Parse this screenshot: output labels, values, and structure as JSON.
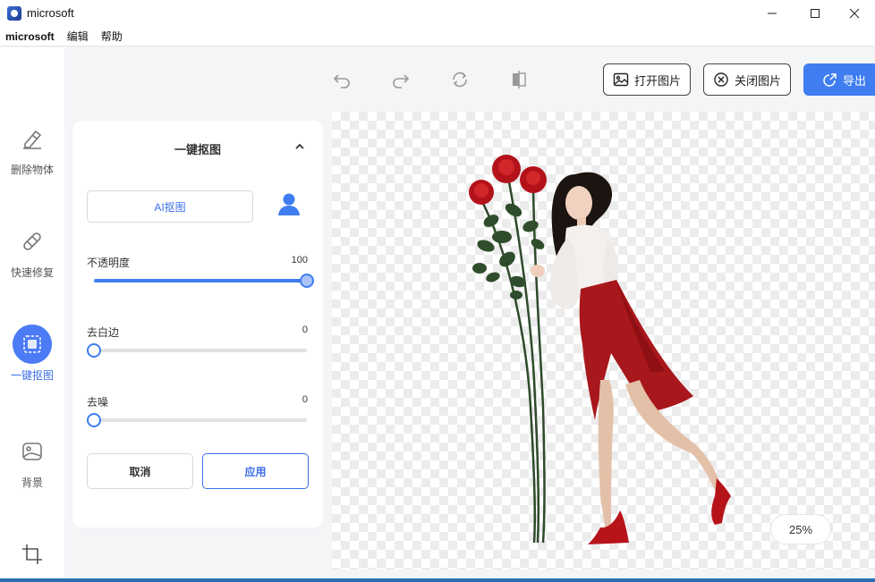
{
  "window": {
    "title": "microsoft"
  },
  "menu": {
    "app": "microsoft",
    "edit": "编辑",
    "help": "帮助"
  },
  "sidebar": {
    "items": [
      {
        "label": "删除物体",
        "icon": "eraser-icon"
      },
      {
        "label": "快速修复",
        "icon": "bandage-icon"
      },
      {
        "label": "一键抠图",
        "icon": "cutout-icon",
        "active": true
      },
      {
        "label": "背景",
        "icon": "image-icon"
      },
      {
        "label": "",
        "icon": "crop-icon"
      }
    ]
  },
  "toolbar": {
    "open_label": "打开图片",
    "close_label": "关闭图片",
    "export_label": "导出"
  },
  "panel": {
    "title": "一键抠图",
    "ai_button": "AI抠图",
    "opacity": {
      "label": "不透明度",
      "value": "100",
      "level": 1.0
    },
    "whiteedge": {
      "label": "去白边",
      "value": "0",
      "level": 0.0
    },
    "denoise": {
      "label": "去噪",
      "value": "0",
      "level": 0.0
    },
    "cancel_label": "取消",
    "apply_label": "应用"
  },
  "canvas": {
    "zoom": "25%"
  },
  "colors": {
    "accent": "#3f7df0",
    "rose": "#c0161b",
    "skirt": "#b01b1b"
  }
}
